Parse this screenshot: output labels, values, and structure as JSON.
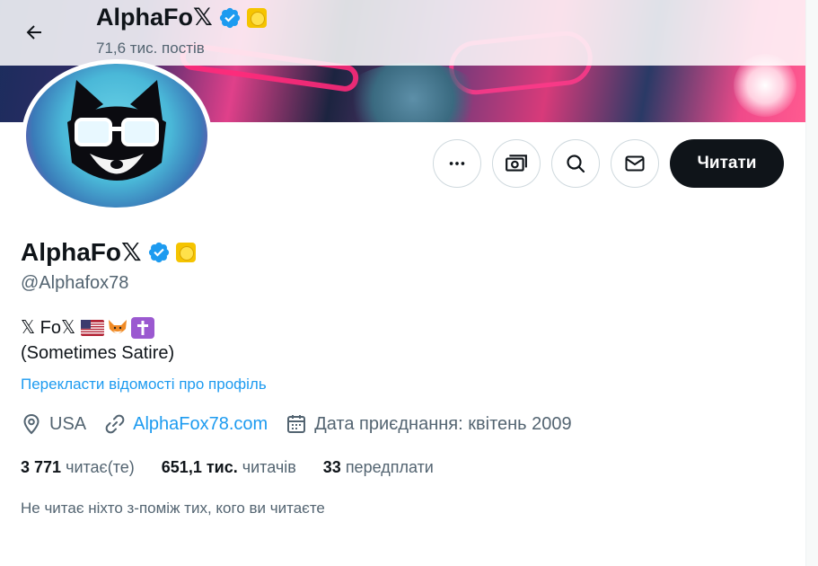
{
  "header": {
    "name": "AlphaFo𝕏",
    "posts": "71,6 тис. постів"
  },
  "actions": {
    "follow_label": "Читати"
  },
  "profile": {
    "name": "AlphaFo𝕏",
    "handle": "@Alphafox78",
    "bio_line1_text": "𝕏 Fo𝕏",
    "bio_line2": "(Sometimes Satire)",
    "translate_link": "Перекласти відомості про профіль",
    "location": "USA",
    "website": "AlphaFox78.com",
    "joined": "Дата приєднання: квітень 2009"
  },
  "stats": {
    "following_count": "3 771",
    "following_label": "читає(те)",
    "followers_count": "651,1 тис.",
    "followers_label": "читачів",
    "subs_count": "33",
    "subs_label": "передплати"
  },
  "note": "Не читає ніхто з-поміж тих, кого ви читаєте",
  "colors": {
    "accent": "#1d9bf0",
    "text": "#0f1419",
    "secondary": "#536471",
    "follow_bg": "#0f1419"
  },
  "icons": [
    "arrow-left-icon",
    "verified-badge-icon",
    "gold-badge-icon",
    "more-icon",
    "subscribe-icon",
    "search-icon",
    "mail-icon",
    "location-icon",
    "link-icon",
    "calendar-icon",
    "us-flag-icon",
    "fox-icon",
    "cross-icon"
  ]
}
